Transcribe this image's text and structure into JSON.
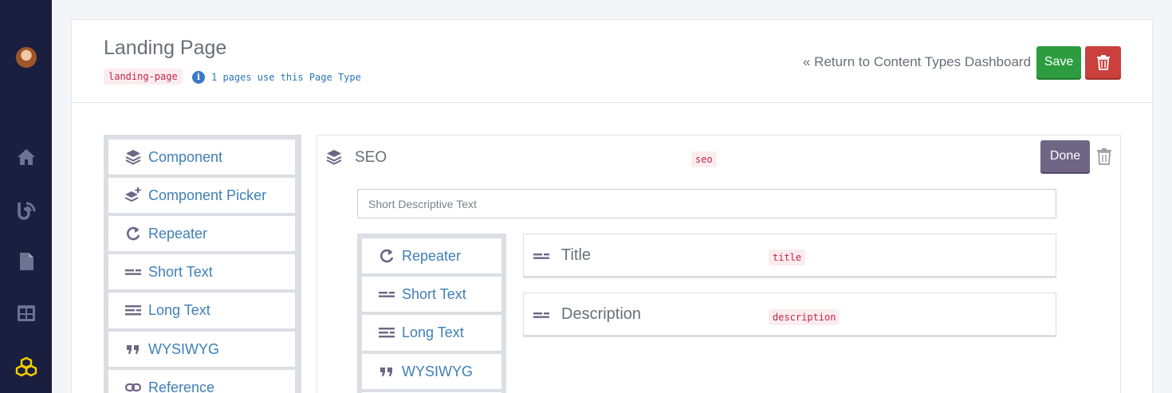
{
  "sidebar": {
    "avatar": "user-avatar",
    "nav_icons": [
      "home-icon",
      "blog-icon",
      "page-icon",
      "layout-icon",
      "cubes-icon"
    ],
    "active_color": "#f5d000"
  },
  "header": {
    "title": "Landing Page",
    "slug": "landing-page",
    "info_icon": "i",
    "usage_text": "1 pages use this Page Type",
    "return_link": "« Return to Content Types Dashboard",
    "save_label": "Save"
  },
  "palette": {
    "items": [
      {
        "icon": "layers-icon",
        "label": "Component"
      },
      {
        "icon": "layers-plus-icon",
        "label": "Component Picker"
      },
      {
        "icon": "repeat-icon",
        "label": "Repeater"
      },
      {
        "icon": "short-text-icon",
        "label": "Short Text"
      },
      {
        "icon": "long-text-icon",
        "label": "Long Text"
      },
      {
        "icon": "quote-icon",
        "label": "WYSIWYG"
      },
      {
        "icon": "link-icon",
        "label": "Reference"
      }
    ]
  },
  "component": {
    "title": "SEO",
    "key": "seo",
    "done_label": "Done",
    "description_placeholder": "Short Descriptive Text",
    "palette_items": [
      {
        "icon": "repeat-icon",
        "label": "Repeater"
      },
      {
        "icon": "short-text-icon",
        "label": "Short Text"
      },
      {
        "icon": "long-text-icon",
        "label": "Long Text"
      },
      {
        "icon": "quote-icon",
        "label": "WYSIWYG"
      }
    ],
    "fields": [
      {
        "icon": "short-text-icon",
        "name": "Title",
        "key": "title"
      },
      {
        "icon": "short-text-icon",
        "name": "Description",
        "key": "description"
      }
    ]
  },
  "colors": {
    "sidebar_bg": "#1b1f3f",
    "save_green": "#2c9c3f",
    "delete_red": "#c9403c",
    "done_purple": "#6f6585",
    "link_blue": "#3e7fb8",
    "badge_red": "#c2274a"
  }
}
